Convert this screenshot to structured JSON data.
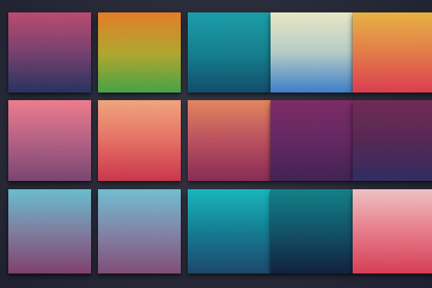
{
  "swatches": [
    {
      "row": 1,
      "col": 1,
      "colors": [
        "#b8496e",
        "#743e6c",
        "#24305c"
      ]
    },
    {
      "row": 1,
      "col": 2,
      "colors": [
        "#e27b26",
        "#b0a52c",
        "#45a045"
      ]
    },
    {
      "row": 1,
      "col": 3,
      "colors": [
        "#199ba6",
        "#117e8e",
        "#0f4a66"
      ]
    },
    {
      "row": 1,
      "col": 4,
      "colors": [
        "#e8e6c4",
        "#b3cbc4",
        "#3b7cc8"
      ]
    },
    {
      "row": 1,
      "col": 5,
      "colors": [
        "#e6b040",
        "#e37a46",
        "#d93a4e"
      ]
    },
    {
      "row": 2,
      "col": 1,
      "colors": [
        "#ec7a8c",
        "#b25f82",
        "#76436e"
      ]
    },
    {
      "row": 2,
      "col": 2,
      "colors": [
        "#eea47c",
        "#e56d62",
        "#c7344a"
      ]
    },
    {
      "row": 2,
      "col": 3,
      "colors": [
        "#e1845c",
        "#b94d5c",
        "#852a54"
      ]
    },
    {
      "row": 2,
      "col": 4,
      "colors": [
        "#7a2962",
        "#612460",
        "#3e2050"
      ]
    },
    {
      "row": 2,
      "col": 5,
      "colors": [
        "#6c2852",
        "#542452",
        "#2c2a5e"
      ]
    },
    {
      "row": 3,
      "col": 1,
      "colors": [
        "#66bccd",
        "#7c7c9e",
        "#7d3e6a"
      ]
    },
    {
      "row": 3,
      "col": 2,
      "colors": [
        "#6ebdd0",
        "#7f83a7",
        "#7e4b74"
      ]
    },
    {
      "row": 3,
      "col": 3,
      "colors": [
        "#14b6bb",
        "#127a90",
        "#18456a"
      ]
    },
    {
      "row": 3,
      "col": 4,
      "colors": [
        "#0f7f86",
        "#0f4f66",
        "#0e1e3a"
      ]
    },
    {
      "row": 3,
      "col": 5,
      "colors": [
        "#eec0c2",
        "#e57a88",
        "#d63b52"
      ]
    }
  ]
}
